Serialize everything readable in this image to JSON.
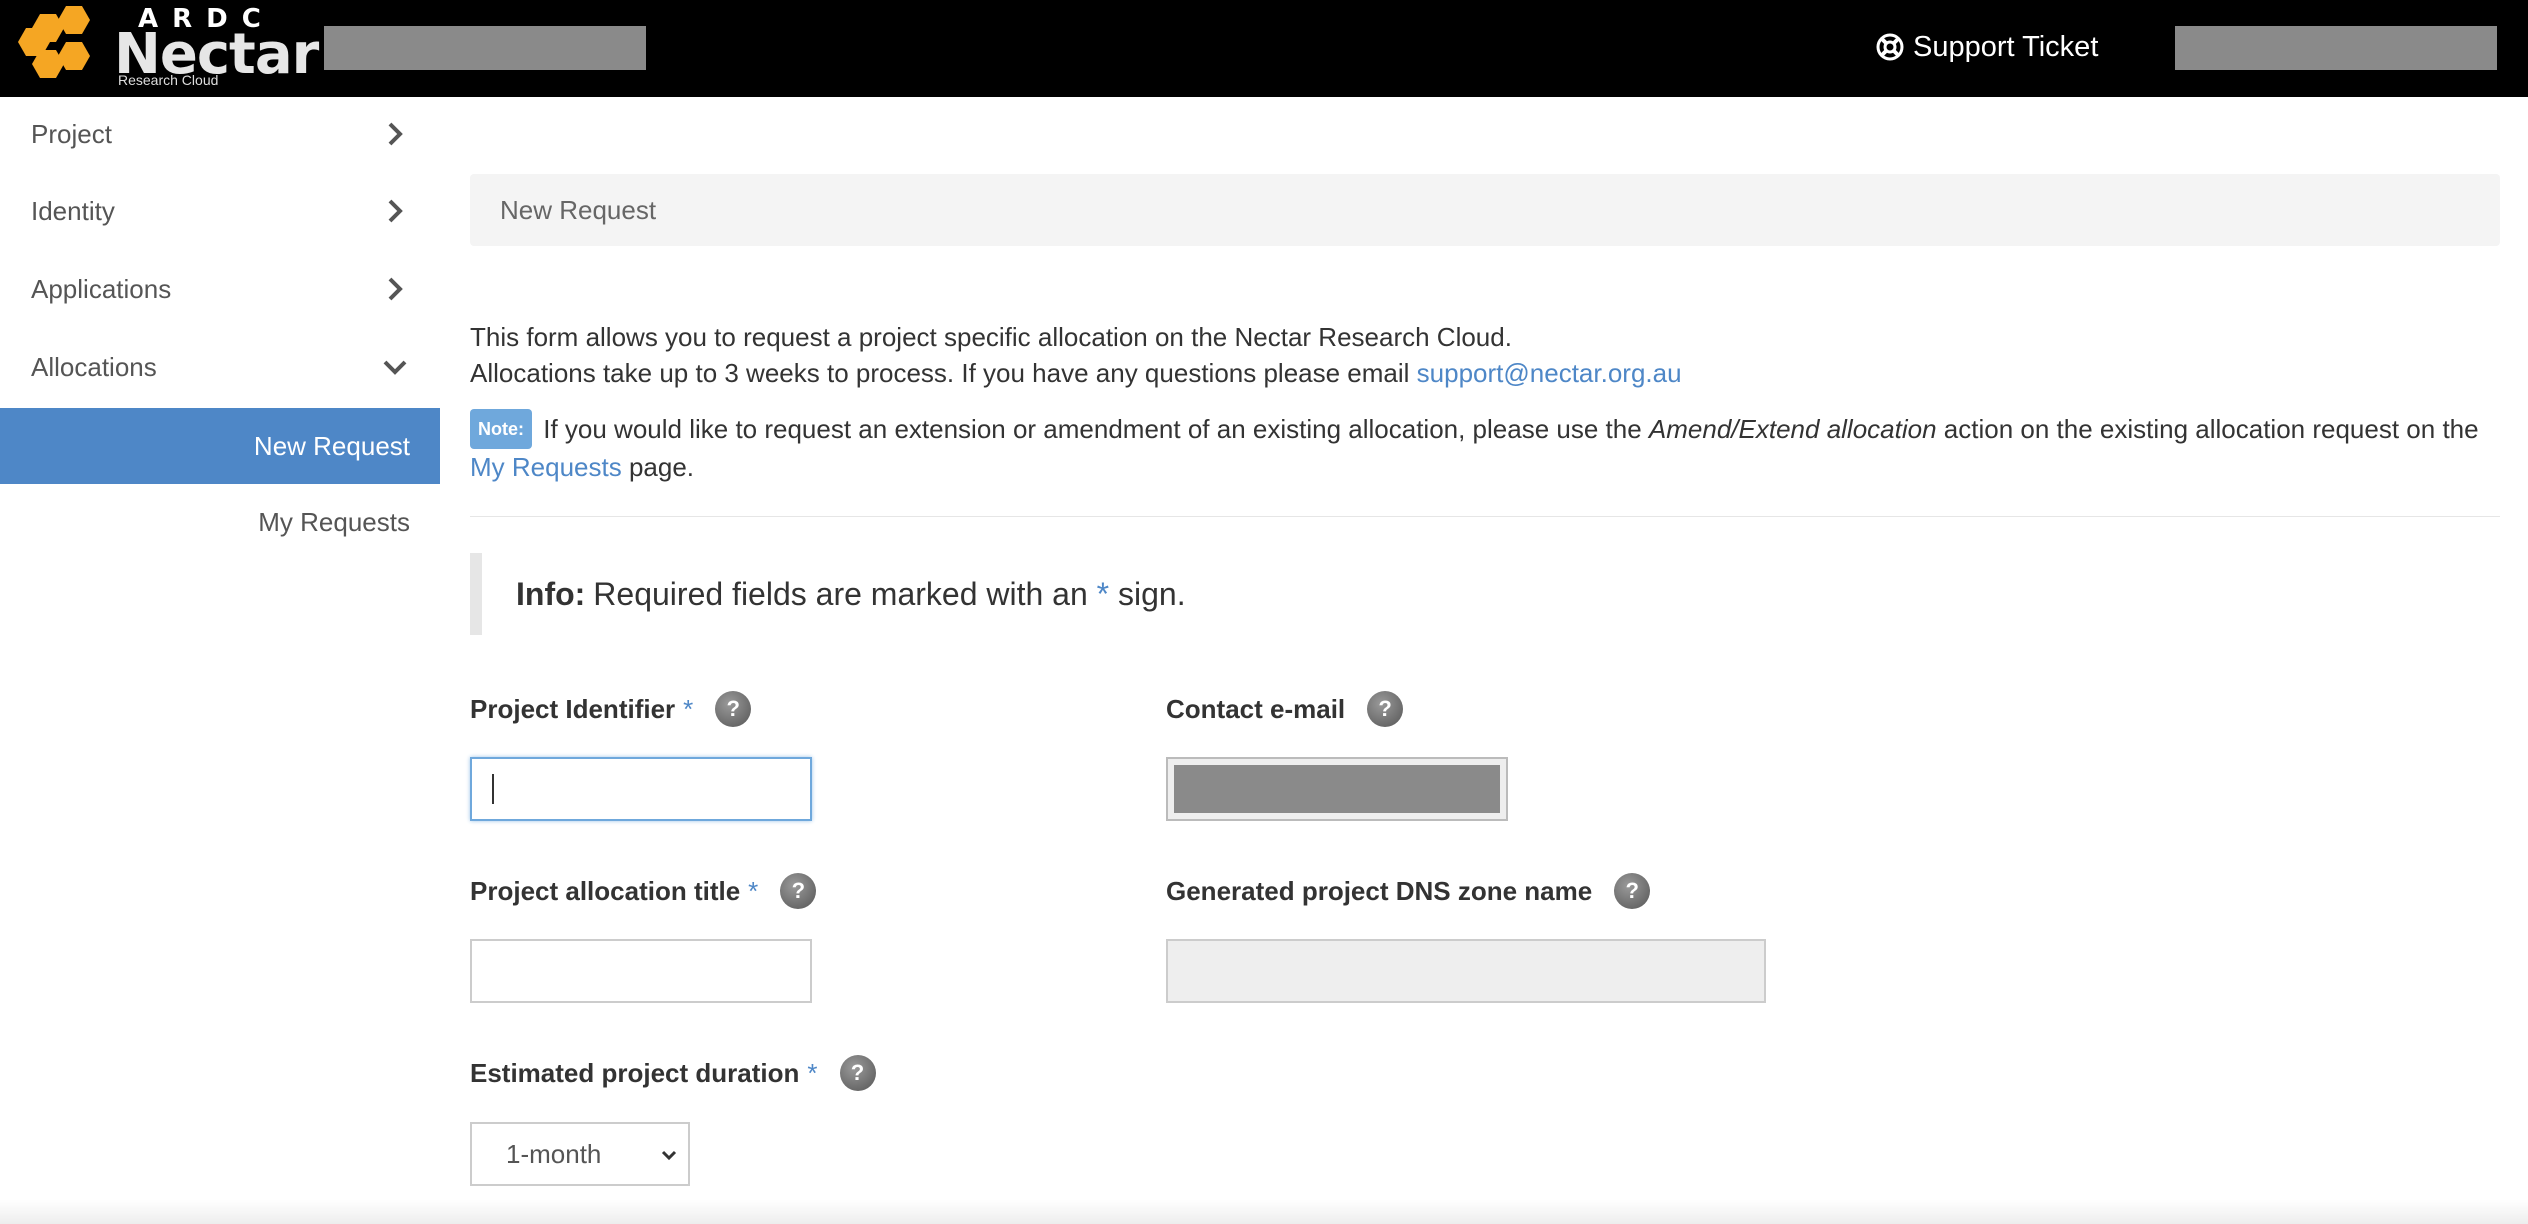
{
  "header": {
    "logo_top": "ARDC",
    "logo_main": "Nectar",
    "logo_sub": "Research Cloud",
    "support_label": "Support Ticket",
    "brand_colors": {
      "hex": "#f5a623",
      "bar": "#000000"
    }
  },
  "sidebar": {
    "items": [
      {
        "label": "Project",
        "icon": "chevron-right-icon"
      },
      {
        "label": "Identity",
        "icon": "chevron-right-icon"
      },
      {
        "label": "Applications",
        "icon": "chevron-right-icon"
      },
      {
        "label": "Allocations",
        "icon": "chevron-down-icon"
      }
    ],
    "subitems": [
      {
        "label": "New Request",
        "active": true
      },
      {
        "label": "My Requests",
        "active": false
      }
    ],
    "accent": "#4e87c7"
  },
  "main": {
    "breadcrumb": "New Request",
    "intro_line1": "This form allows you to request a project specific allocation on the Nectar Research Cloud.",
    "intro_line2": "Allocations take up to 3 weeks to process. If you have any questions please email",
    "support_email": "support@nectar.org.au",
    "note_badge": "Note:",
    "note_part1": "If you would like to request an extension or amendment of an existing allocation, please use the",
    "note_italic": "Amend/Extend allocation",
    "note_part2": "action on the existing allocation request on the",
    "note_link": "My Requests",
    "note_part3": "page.",
    "info_bold": "Info:",
    "info_part1": "Required fields are marked with an",
    "info_star": "*",
    "info_part2": "sign."
  },
  "form": {
    "project_identifier": {
      "label": "Project Identifier",
      "required_mark": "*",
      "value": ""
    },
    "contact_email": {
      "label": "Contact e-mail"
    },
    "allocation_title": {
      "label": "Project allocation title",
      "required_mark": "*",
      "value": ""
    },
    "dns_zone": {
      "label": "Generated project DNS zone name",
      "value": ""
    },
    "duration": {
      "label": "Estimated project duration",
      "required_mark": "*",
      "selected": "1-month"
    },
    "help_glyph": "?"
  }
}
